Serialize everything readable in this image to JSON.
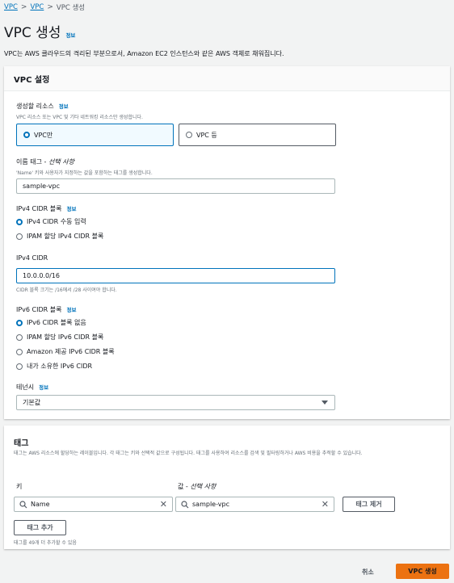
{
  "breadcrumb": {
    "items": [
      "VPC",
      "VPC",
      "VPC 생성"
    ],
    "separator": ">"
  },
  "page": {
    "title": "VPC 생성",
    "info_label": "정보",
    "description": "VPC는 AWS 클라우드의 격리된 부분으로서, Amazon EC2 인스턴스와 같은 AWS 객체로 채워집니다."
  },
  "vpc_settings": {
    "header": "VPC 설정",
    "resources": {
      "label": "생성할 리소스",
      "info": "정보",
      "description": "VPC 리소스 또는 VPC 및 기타 네트워킹 리소스만 생성합니다.",
      "options": [
        "VPC만",
        "VPC 등"
      ],
      "selected": 0
    },
    "name_tag": {
      "label": "이름 태그 - ",
      "optional": "선택 사항",
      "description": "'Name' 키와 사용자가 지정하는 값을 포함하는 태그를 생성합니다.",
      "value": "sample-vpc"
    },
    "ipv4_block": {
      "label": "IPv4 CIDR 블록",
      "info": "정보",
      "options": [
        "IPv4 CIDR 수동 입력",
        "IPAM 할당 IPv4 CIDR 블록"
      ],
      "selected": 0
    },
    "ipv4_cidr": {
      "label": "IPv4 CIDR",
      "value": "10.0.0.0/16",
      "hint": "CIDR 블록 크기는 /16에서 /28 사이여야 합니다."
    },
    "ipv6_block": {
      "label": "IPv6 CIDR 블록",
      "info": "정보",
      "options": [
        "IPv6 CIDR 블록 없음",
        "IPAM 할당 IPv6 CIDR 블록",
        "Amazon 제공 IPv6 CIDR 블록",
        "내가 소유한 IPv6 CIDR"
      ],
      "selected": 0
    },
    "tenancy": {
      "label": "테넌시",
      "info": "정보",
      "value": "기본값"
    }
  },
  "tags": {
    "header": "태그",
    "description": "태그는 AWS 리소스에 할당하는 레이블입니다. 각 태그는 키와 선택적 값으로 구성됩니다. 태그를 사용하여 리소스를 검색 및 필터링하거나 AWS 비용을 추적할 수 있습니다.",
    "key_label": "키",
    "value_label": "값 - ",
    "value_optional": "선택 사항",
    "key_value": "Name",
    "value_value": "sample-vpc",
    "remove_button": "태그 제거",
    "add_button": "태그 추가",
    "remaining_hint": "태그를 49개 더 추가할 수 있음"
  },
  "footer": {
    "cancel": "취소",
    "create": "VPC 생성"
  },
  "colors": {
    "accent": "#0073bb",
    "primary": "#ec7211",
    "background": "#f2f3f3"
  }
}
